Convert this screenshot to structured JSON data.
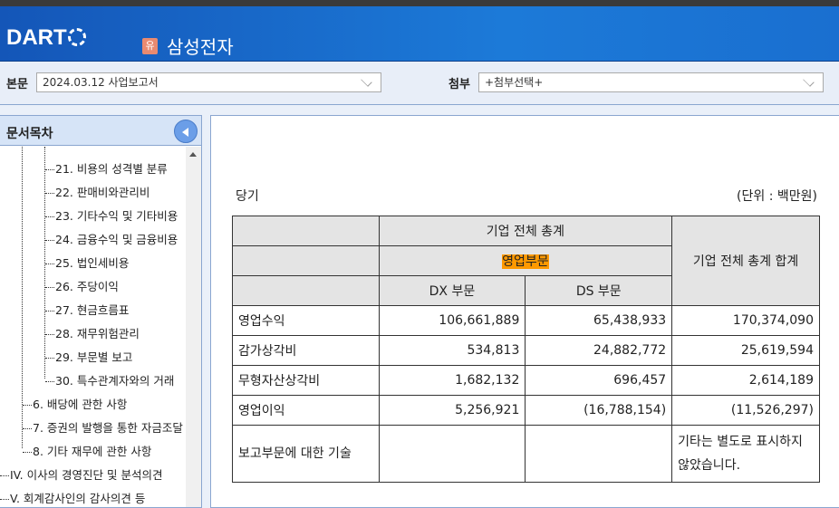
{
  "header": {
    "logo": "DART",
    "badge": "유",
    "company": "삼성전자"
  },
  "toolbar": {
    "main_label": "본문",
    "main_value": "2024.03.12  사업보고서",
    "attach_label": "첨부",
    "attach_value": "+첨부선택+"
  },
  "toc": {
    "title": "문서목차",
    "items": [
      "21. 비용의 성격별 분류",
      "22. 판매비와관리비",
      "23. 기타수익 및 기타비용",
      "24. 금융수익 및 금융비용",
      "25. 법인세비용",
      "26. 주당이익",
      "27. 현금흐름표",
      "28. 재무위험관리",
      "29. 부문별 보고",
      "30. 특수관계자와의 거래",
      "6. 배당에 관한 사항",
      "7. 증권의 발행을 통한 자금조달",
      "8. 기타 재무에 관한 사항",
      "IV. 이사의 경영진단 및 분석의견",
      "V. 회계감사인의 감사의견 등"
    ]
  },
  "doc": {
    "period": "당기",
    "unit": "(단위 : 백만원)",
    "table": {
      "h_total": "기업 전체 총계",
      "h_segment": "영업부문",
      "h_dx": "DX 부문",
      "h_ds": "DS 부문",
      "h_sum": "기업 전체 총계  합계",
      "rows": [
        {
          "label": "영업수익",
          "dx": "106,661,889",
          "ds": "65,438,933",
          "sum": "170,374,090"
        },
        {
          "label": "감가상각비",
          "dx": "534,813",
          "ds": "24,882,772",
          "sum": "25,619,594"
        },
        {
          "label": "무형자산상각비",
          "dx": "1,682,132",
          "ds": "696,457",
          "sum": "2,614,189"
        },
        {
          "label": "영업이익",
          "dx": "5,256,921",
          "ds": "(16,788,154)",
          "sum": "(11,526,297)"
        },
        {
          "label": "보고부문에 대한 기술",
          "dx": "",
          "ds": "",
          "sum": "기타는 별도로 표시하지 않았습니다."
        }
      ]
    }
  }
}
